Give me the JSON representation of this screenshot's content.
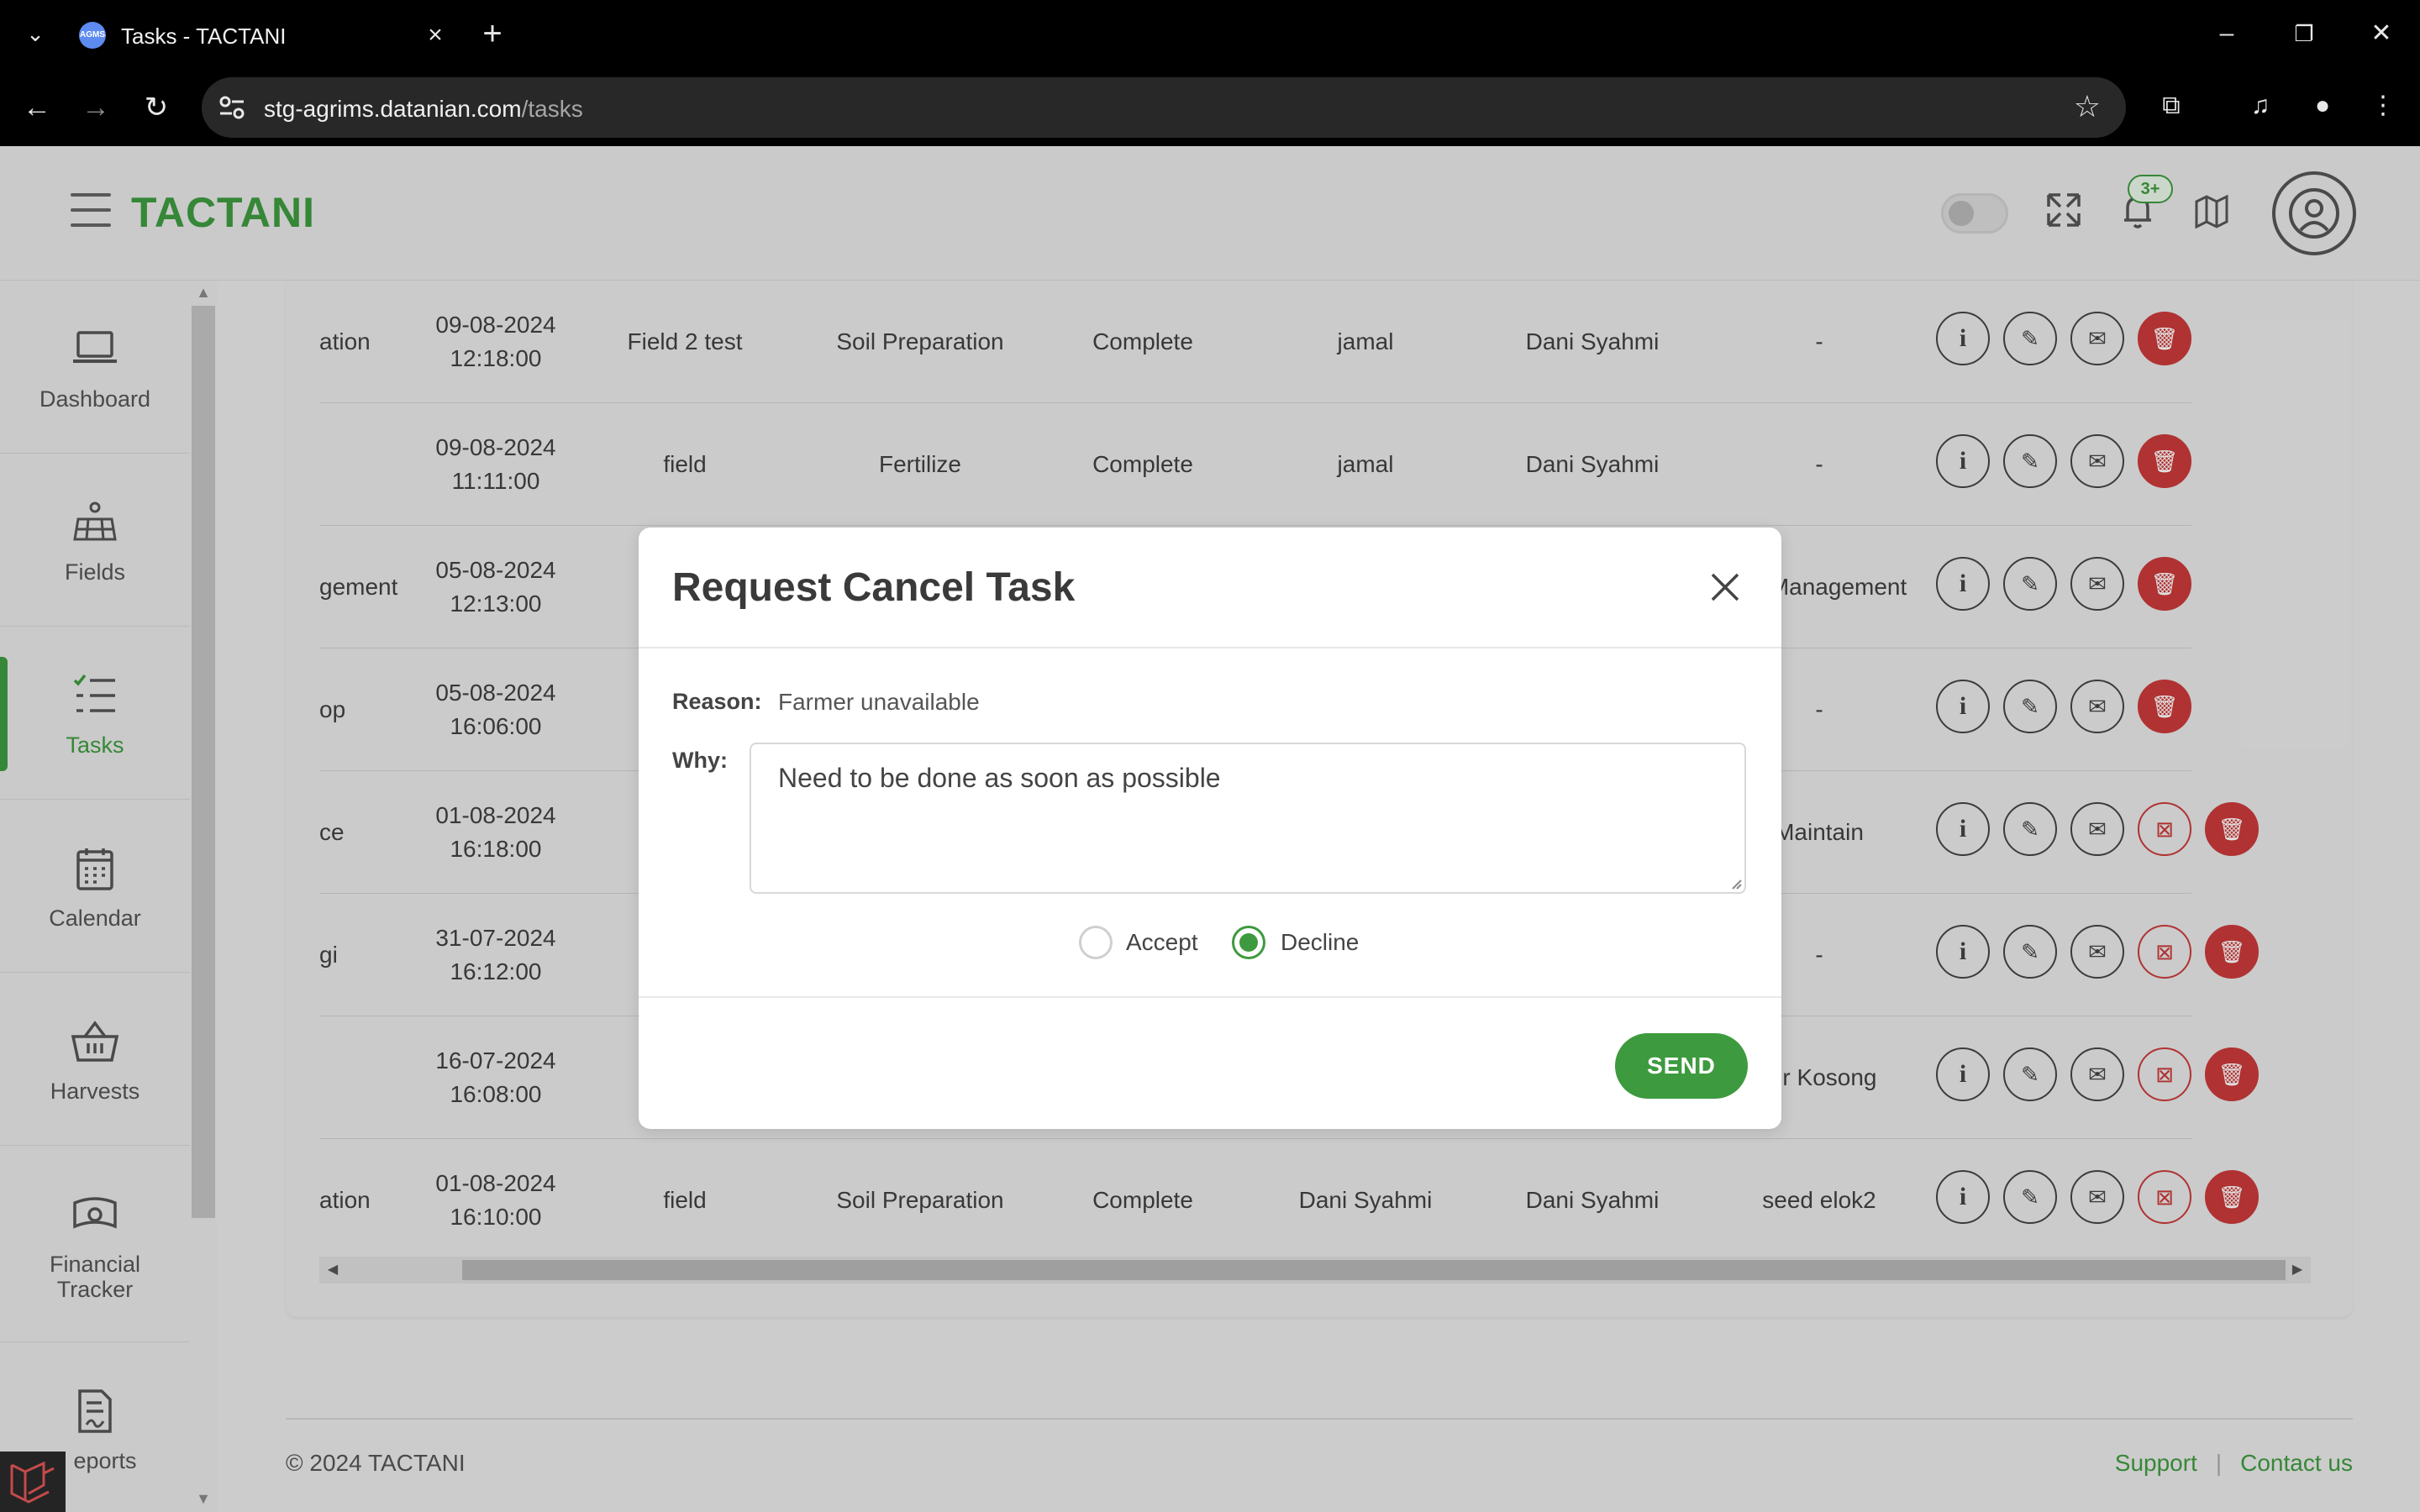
{
  "browser": {
    "tab_title": "Tasks - TACTANI",
    "favicon_text": "AGMS",
    "url_domain": "stg-agrims.datanian.com",
    "url_path": "/tasks"
  },
  "app": {
    "brand": "TACTANI",
    "notification_count": "3+"
  },
  "sidebar": {
    "items": [
      {
        "label": "Dashboard",
        "icon": "laptop-icon"
      },
      {
        "label": "Fields",
        "icon": "field-icon"
      },
      {
        "label": "Tasks",
        "icon": "tasks-icon",
        "active": true
      },
      {
        "label": "Calendar",
        "icon": "calendar-icon"
      },
      {
        "label": "Harvests",
        "icon": "basket-icon"
      },
      {
        "label": "Financial Tracker",
        "icon": "money-icon"
      },
      {
        "label": "eports",
        "icon": "report-icon"
      }
    ]
  },
  "table": {
    "rows": [
      {
        "c0": "ation",
        "date": "09-08-2024",
        "time": "12:18:00",
        "field": "Field 2 test",
        "type": "Soil Preparation",
        "status": "Complete",
        "assigned": "jamal",
        "by": "Dani Syahmi",
        "note": "-",
        "has_cancel": false
      },
      {
        "c0": "",
        "date": "09-08-2024",
        "time": "11:11:00",
        "field": "field",
        "type": "Fertilize",
        "status": "Complete",
        "assigned": "jamal",
        "by": "Dani Syahmi",
        "note": "-",
        "has_cancel": false
      },
      {
        "c0": "gement",
        "date": "05-08-2024",
        "time": "12:13:00",
        "field": "",
        "type": "",
        "status": "",
        "assigned": "",
        "by": "",
        "note": "est Management",
        "has_cancel": false
      },
      {
        "c0": "op",
        "date": "05-08-2024",
        "time": "16:06:00",
        "field": "",
        "type": "",
        "status": "",
        "assigned": "",
        "by": "",
        "note": "-",
        "has_cancel": false
      },
      {
        "c0": "ce",
        "date": "01-08-2024",
        "time": "16:18:00",
        "field": "",
        "type": "",
        "status": "",
        "assigned": "",
        "by": "",
        "note": "Maintain",
        "has_cancel": true
      },
      {
        "c0": "gi",
        "date": "31-07-2024",
        "time": "16:12:00",
        "field": "",
        "type": "",
        "status": "",
        "assigned": "",
        "by": "",
        "note": "-",
        "has_cancel": true
      },
      {
        "c0": "",
        "date": "16-07-2024",
        "time": "16:08:00",
        "field": "",
        "type": "",
        "status": "",
        "assigned": "",
        "by": "",
        "note": "Air Kosong",
        "has_cancel": true
      },
      {
        "c0": "ation",
        "date": "01-08-2024",
        "time": "16:10:00",
        "field": "field",
        "type": "Soil Preparation",
        "status": "Complete",
        "assigned": "Dani Syahmi",
        "by": "Dani Syahmi",
        "note": "seed elok2",
        "has_cancel": true
      }
    ]
  },
  "modal": {
    "title": "Request Cancel Task",
    "reason_label": "Reason:",
    "reason_value": "Farmer unavailable",
    "why_label": "Why:",
    "why_value": "Need to be done as soon as possible",
    "accept_label": "Accept",
    "decline_label": "Decline",
    "selected": "Decline",
    "send_label": "SEND"
  },
  "footer": {
    "copyright": "© 2024 TACTANI",
    "support": "Support",
    "contact": "Contact us"
  },
  "colors": {
    "brand": "#3e9a3f",
    "danger": "#c93a3a"
  }
}
